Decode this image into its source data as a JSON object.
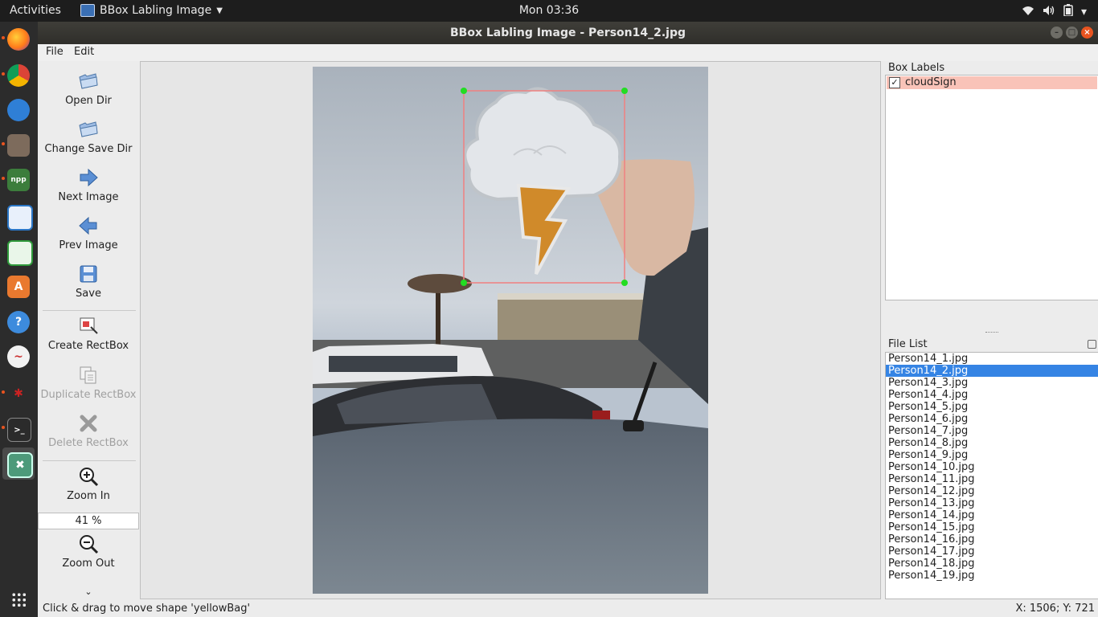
{
  "topbar": {
    "activities": "Activities",
    "app_name": "BBox Labling Image",
    "clock": "Mon 03:36",
    "tray_icons": [
      "wifi-icon",
      "volume-icon",
      "battery-icon",
      "system-menu-icon"
    ]
  },
  "window": {
    "title": "BBox Labling Image - Person14_2.jpg"
  },
  "dock": {
    "items": [
      "firefox",
      "chrome",
      "thunderbird",
      "files",
      "notepadqq",
      "writer",
      "calc",
      "software-center",
      "help",
      "clipboard",
      "spiderweb-app",
      "terminal",
      "bbox-labeler"
    ],
    "active": "bbox-labeler"
  },
  "menu": {
    "file": "File",
    "edit": "Edit"
  },
  "toolbar": {
    "open_dir": "Open Dir",
    "change_save_dir": "Change Save Dir",
    "next_image": "Next Image",
    "prev_image": "Prev Image",
    "save": "Save",
    "create_rectbox": "Create RectBox",
    "duplicate_rectbox": "Duplicate RectBox",
    "delete_rectbox": "Delete RectBox",
    "zoom_in": "Zoom In",
    "zoom_value": "41 %",
    "zoom_out": "Zoom Out",
    "more": "⌄"
  },
  "box_labels": {
    "title": "Box Labels",
    "items": [
      {
        "label": "cloudSign",
        "checked": true,
        "check_mark": "✓",
        "color": "#f9c3b8"
      }
    ]
  },
  "file_list": {
    "title": "File List",
    "selected": "Person14_2.jpg",
    "files": [
      "Person14_1.jpg",
      "Person14_2.jpg",
      "Person14_3.jpg",
      "Person14_4.jpg",
      "Person14_5.jpg",
      "Person14_6.jpg",
      "Person14_7.jpg",
      "Person14_8.jpg",
      "Person14_9.jpg",
      "Person14_10.jpg",
      "Person14_11.jpg",
      "Person14_12.jpg",
      "Person14_13.jpg",
      "Person14_14.jpg",
      "Person14_15.jpg",
      "Person14_16.jpg",
      "Person14_17.jpg",
      "Person14_18.jpg",
      "Person14_19.jpg"
    ]
  },
  "status": {
    "message": "Click & drag to move shape 'yellowBag'",
    "coords": "X: 1506; Y: 721"
  },
  "colors": {
    "accent": "#e95420",
    "selection": "#3584e4",
    "bbox": "#f08080",
    "handle": "#22dd22"
  }
}
